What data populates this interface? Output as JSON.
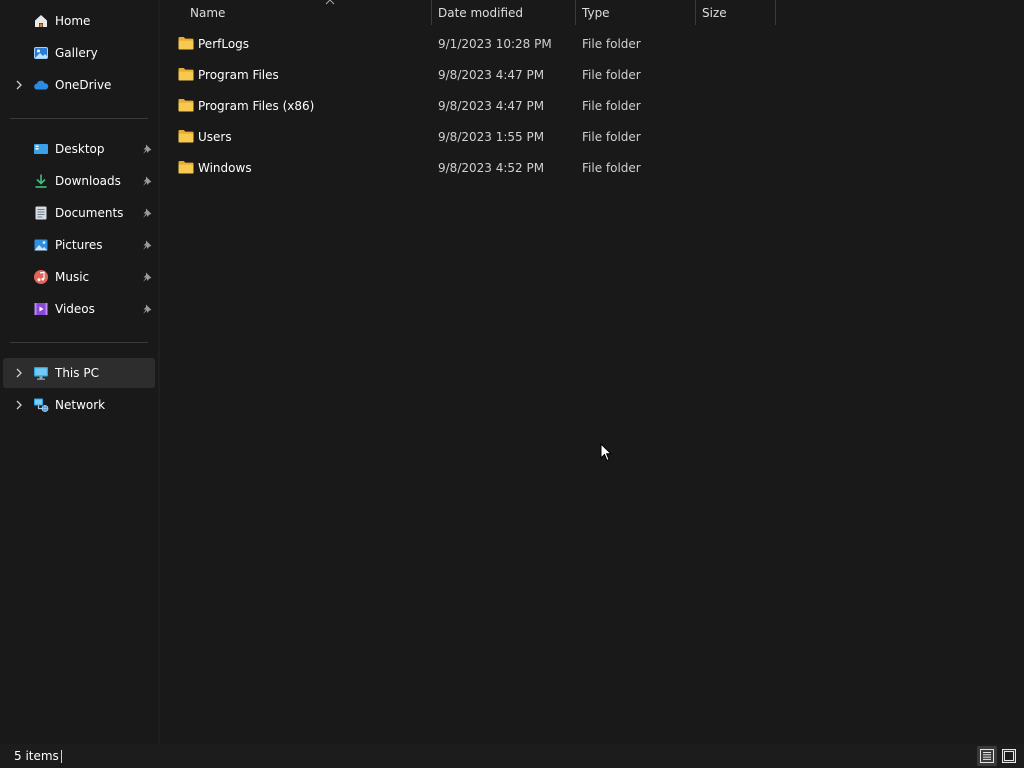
{
  "nav": {
    "quick": [
      {
        "label": "Home",
        "icon": "home-icon",
        "expandable": false
      },
      {
        "label": "Gallery",
        "icon": "gallery-icon",
        "expandable": false
      },
      {
        "label": "OneDrive",
        "icon": "onedrive-icon",
        "expandable": true
      }
    ],
    "pinned": [
      {
        "label": "Desktop",
        "icon": "desktop-icon"
      },
      {
        "label": "Downloads",
        "icon": "downloads-icon"
      },
      {
        "label": "Documents",
        "icon": "documents-icon"
      },
      {
        "label": "Pictures",
        "icon": "pictures-icon"
      },
      {
        "label": "Music",
        "icon": "music-icon"
      },
      {
        "label": "Videos",
        "icon": "videos-icon"
      }
    ],
    "locations": [
      {
        "label": "This PC",
        "icon": "this-pc-icon",
        "selected": true
      },
      {
        "label": "Network",
        "icon": "network-icon",
        "selected": false
      }
    ]
  },
  "columns": {
    "name": "Name",
    "date": "Date modified",
    "type": "Type",
    "size": "Size",
    "sort_indicator": "sort-ascending-icon"
  },
  "files": [
    {
      "name": "PerfLogs",
      "date": "9/1/2023 10:28 PM",
      "type": "File folder",
      "size": ""
    },
    {
      "name": "Program Files",
      "date": "9/8/2023 4:47 PM",
      "type": "File folder",
      "size": ""
    },
    {
      "name": "Program Files (x86)",
      "date": "9/8/2023 4:47 PM",
      "type": "File folder",
      "size": ""
    },
    {
      "name": "Users",
      "date": "9/8/2023 1:55 PM",
      "type": "File folder",
      "size": ""
    },
    {
      "name": "Windows",
      "date": "9/8/2023 4:52 PM",
      "type": "File folder",
      "size": ""
    }
  ],
  "status": {
    "item_count": "5 items"
  },
  "colors": {
    "background": "#191919",
    "folder": "#f5c04a",
    "selected_row": "#2d2d2d",
    "accent": "#4cc2ff"
  }
}
